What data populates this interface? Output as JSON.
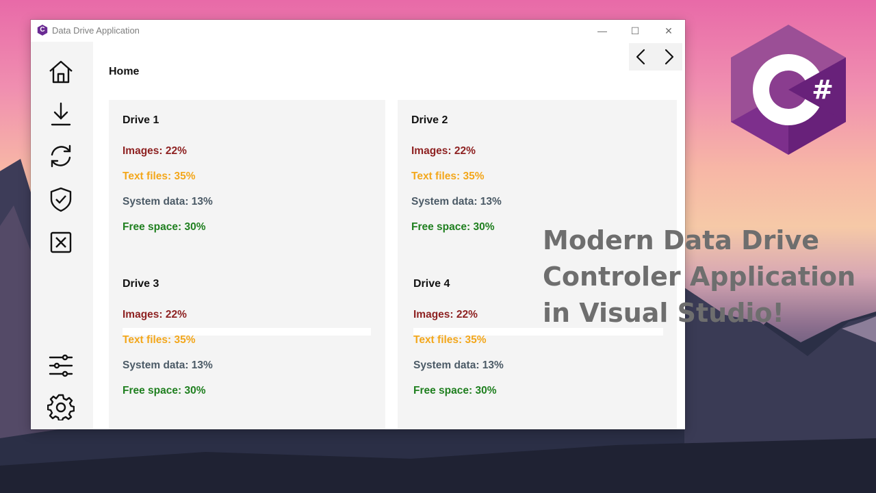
{
  "window": {
    "title": "Data Drive Application",
    "app_icon": "C",
    "controls": {
      "minimize": "—",
      "maximize": "☐",
      "close": "✕"
    }
  },
  "sidebar": {
    "items": [
      {
        "name": "home-icon"
      },
      {
        "name": "download-icon"
      },
      {
        "name": "refresh-icon"
      },
      {
        "name": "shield-check-icon"
      },
      {
        "name": "close-box-icon"
      },
      {
        "name": "sliders-icon"
      },
      {
        "name": "gear-icon"
      }
    ]
  },
  "header": {
    "title": "Home",
    "back_icon": "chevron-left-icon",
    "forward_icon": "chevron-right-icon"
  },
  "drives": [
    {
      "title": "Drive 1",
      "images": "Images: 22%",
      "text": "Text files: 35%",
      "system": "System data: 13%",
      "free": "Free space: 30%"
    },
    {
      "title": "Drive 2",
      "images": "Images: 22%",
      "text": "Text files: 35%",
      "system": "System data: 13%",
      "free": "Free space: 30%"
    },
    {
      "title": "Drive 3",
      "images": "Images: 22%",
      "text": "Text files: 35%",
      "system": "System data: 13%",
      "free": "Free space: 30%"
    },
    {
      "title": "Drive 4",
      "images": "Images: 22%",
      "text": "Text files: 35%",
      "system": "System data: 13%",
      "free": "Free space: 30%"
    }
  ],
  "overlay": {
    "line1": "Modern Data Drive",
    "line2": "Controler Application",
    "line3": "in Visual Studio!"
  },
  "logo": {
    "symbol": "#"
  },
  "colors": {
    "images": "#8e2222",
    "text_files": "#f3a71b",
    "system_data": "#4b5a66",
    "free_space": "#1f7f1f",
    "logo_purple": "#68217a"
  }
}
